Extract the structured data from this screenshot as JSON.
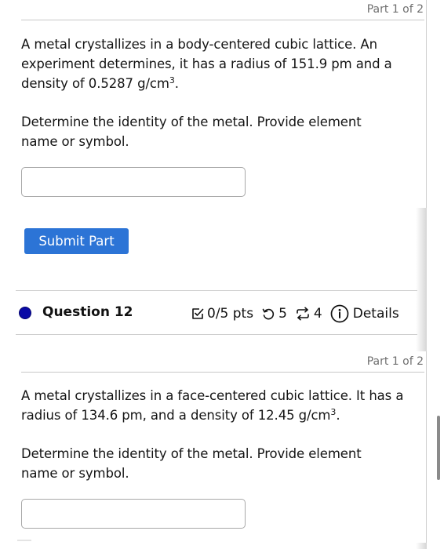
{
  "question_11": {
    "part_label": "Part 1 of 2",
    "prompt_text": "A metal crystallizes in a body-centered cubic lattice. An experiment determines, it has a radius of 151.9 pm and a density of 0.5287 g/cm",
    "prompt_superscript": "3",
    "prompt_end": ".",
    "instruction": "Determine the identity of the metal. Provide element name or symbol.",
    "answer_value": "",
    "answer_placeholder": "",
    "submit_label": "Submit Part"
  },
  "question_12": {
    "title": "Question 12",
    "status_color": "#0a0aa6",
    "points": "0/5 pts",
    "points_icon": "check-square-icon",
    "attempts": "5",
    "attempts_icon": "undo-icon",
    "versions": "4",
    "versions_icon": "repeat-icon",
    "details_label": "Details",
    "details_icon": "info-circle-icon",
    "part_label": "Part 1 of 2",
    "prompt_text": "A metal crystallizes in a face-centered cubic lattice. It has a radius of 134.6 pm, and a density of 12.45 g/cm",
    "prompt_superscript": "3",
    "prompt_end": ".",
    "instruction": "Determine the identity of the metal. Provide element name or symbol.",
    "answer_value": "",
    "answer_placeholder": ""
  },
  "colors": {
    "submit_button": "#2c74d6",
    "part_label": "#6f6f6f",
    "text": "#141414"
  }
}
